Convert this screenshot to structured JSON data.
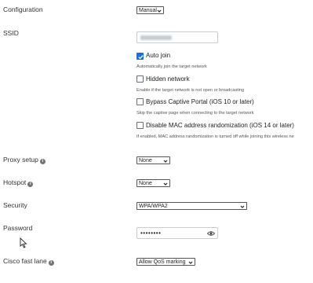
{
  "configuration": {
    "label": "Configuration",
    "selected": "Manual"
  },
  "ssid": {
    "label": "SSID",
    "value": ""
  },
  "auto_join": {
    "label": "Auto join",
    "checked": true,
    "help": "Automatically join the target network"
  },
  "hidden_network": {
    "label": "Hidden network",
    "checked": false,
    "help": "Enable if the target network is not open or broadcasting"
  },
  "bypass_captive_portal": {
    "label": "Bypass Captive Portal (iOS 10 or later)",
    "checked": false,
    "help": "Skip the captive page when connecting to the target network"
  },
  "disable_mac_randomization": {
    "label": "Disable MAC address randomization (iOS 14 or later)",
    "checked": false,
    "help": "If enabled, MAC address randomization is turned off while joining this wireless ne"
  },
  "proxy_setup": {
    "label": "Proxy setup",
    "selected": "None"
  },
  "hotspot": {
    "label": "Hotspot",
    "selected": "None"
  },
  "security": {
    "label": "Security",
    "selected": "WPA/WPA2"
  },
  "password": {
    "label": "Password",
    "masked_value": "••••••••"
  },
  "cisco_fast_lane": {
    "label": "Cisco fast lane",
    "selected": "Allow QoS marking"
  },
  "icons": {
    "info": "info-icon",
    "eye": "eye-icon",
    "chevron": "chevron-down-icon",
    "check": "checkmark-icon",
    "cursor": "mouse-cursor-icon"
  },
  "colors": {
    "accent": "#1d6fd1",
    "text": "#222222",
    "help_text": "#555555",
    "border": "#c9ccd0"
  }
}
